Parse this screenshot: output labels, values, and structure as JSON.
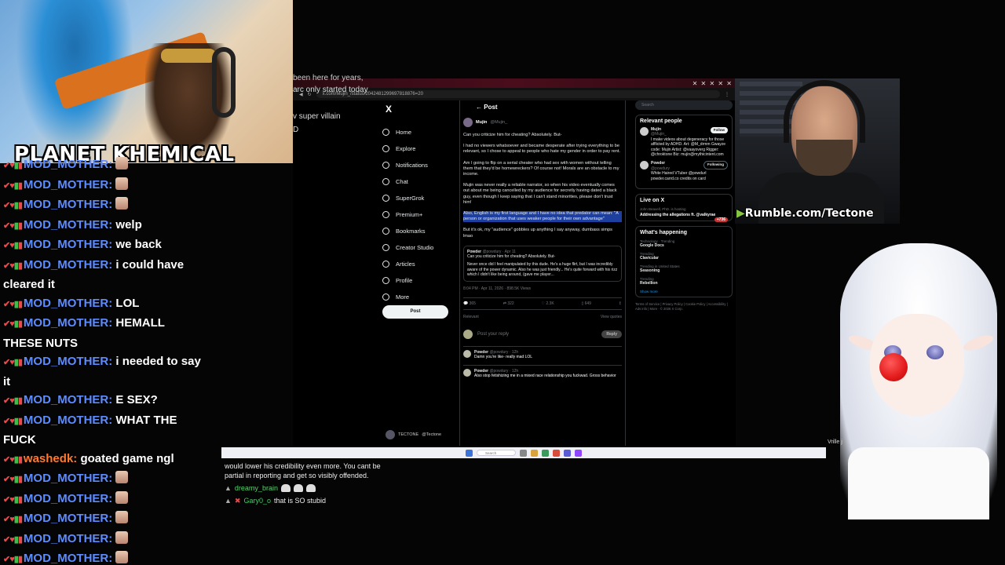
{
  "streamer": {
    "brand": "PLANET KHEMICAL"
  },
  "chat": {
    "messages": [
      {
        "user": "MOD_MOTHER:",
        "text": "",
        "emote": true,
        "color": "#5d8cff"
      },
      {
        "user": "MOD_MOTHER:",
        "text": "",
        "emote": true,
        "color": "#5d8cff"
      },
      {
        "user": "MOD_MOTHER:",
        "text": "",
        "emote": true,
        "color": "#5d8cff"
      },
      {
        "user": "MOD_MOTHER:",
        "text": "welp",
        "emote": false,
        "color": "#5d8cff"
      },
      {
        "user": "MOD_MOTHER:",
        "text": "we back",
        "emote": false,
        "color": "#5d8cff"
      },
      {
        "user": "MOD_MOTHER:",
        "text": "i could have cleared it",
        "emote": false,
        "color": "#5d8cff"
      },
      {
        "user": "MOD_MOTHER:",
        "text": "LOL",
        "emote": false,
        "color": "#5d8cff"
      },
      {
        "user": "MOD_MOTHER:",
        "text": "HEMALL THESE NUTS",
        "emote": false,
        "color": "#5d8cff"
      },
      {
        "user": "MOD_MOTHER:",
        "text": "i needed to say it",
        "emote": false,
        "color": "#5d8cff"
      },
      {
        "user": "MOD_MOTHER:",
        "text": "E SEX?",
        "emote": false,
        "color": "#5d8cff"
      },
      {
        "user": "MOD_MOTHER:",
        "text": "WHAT THE FUCK",
        "emote": false,
        "color": "#5d8cff"
      },
      {
        "user": "washedk:",
        "text": "goated game ngl",
        "emote": false,
        "color": "#ff7a2f"
      },
      {
        "user": "MOD_MOTHER:",
        "text": "",
        "emote": true,
        "color": "#5d8cff"
      },
      {
        "user": "MOD_MOTHER:",
        "text": "",
        "emote": true,
        "color": "#5d8cff"
      },
      {
        "user": "MOD_MOTHER:",
        "text": "",
        "emote": true,
        "color": "#5d8cff"
      },
      {
        "user": "MOD_MOTHER:",
        "text": "",
        "emote": true,
        "color": "#5d8cff"
      },
      {
        "user": "MOD_MOTHER:",
        "text": "",
        "emote": true,
        "color": "#5d8cff"
      },
      {
        "user": "MOD_MOTHER:",
        "text": "",
        "emote": true,
        "color": "#5d8cff"
      }
    ]
  },
  "browser": {
    "url": "x.com/Mujin_/status/2042481299697818876=20",
    "overlay_lines": [
      "been here for years,",
      "arc only started today",
      "v super villain",
      "D"
    ],
    "x_nav": {
      "logo": "X",
      "items": [
        "Home",
        "Explore",
        "Notifications",
        "Chat",
        "SuperGrok",
        "Premium+",
        "Bookmarks",
        "Creator Studio",
        "Articles",
        "Profile",
        "More"
      ],
      "post_label": "Post",
      "account_name": "TECTONE",
      "account_handle": "@Tectone"
    },
    "post": {
      "header": "Post",
      "author": "Mujin",
      "handle": "@Mujin_",
      "paragraphs": [
        "Can you criticize him for cheating? Absolutely. But-",
        "I had no viewers whatsoever and became desperate after trying everything to be relevant, so I chose to appeal to people who hate my gender in order to pay rent.",
        "Am I going to flip on a serial cheater who had sex with women without telling them that they'd be homewreckers? Of course not! Morals are an obstacle to my income.",
        "Mujin was never really a reliable narrator, so when his video eventually comes out about me being cancelled by my audience for secretly having dated a black guy, even though I keep saying that I can't stand minorities, please don't trust him!"
      ],
      "highlighted": "Also, English is my first language and I have no idea that predator can mean: \"A person or organization that uses weaker people for their own advantage\"",
      "closing": "But it's ok, my \"audience\" gobbles up anything I say anyway, dumbass simps lmao",
      "quote_author": "Powder",
      "quote_handle": "@powdury · Apr 11",
      "quote_line1": "Can you criticize him for cheating? Absolutely. But-",
      "quote_line2": "Never once did I feel manipulated by this dude. He's a huge flirt, but I was incredibly aware of the power dynamic. Also he was just friendly... He's quite forward with his rizz which I didn't like being around, (gave me player...",
      "timestamp": "8:04 PM · Apr 11, 2026 · 898.5K Views",
      "actions": [
        "365",
        "322",
        "2.3K",
        "649"
      ],
      "relevant": "Relevant",
      "view_quotes": "View quotes",
      "reply_placeholder": "Post your reply",
      "reply_button": "Reply",
      "replies": [
        {
          "name": "Powder",
          "handle": "@powdury · 12h",
          "text": "Damn you're like- really mad LOL"
        },
        {
          "name": "Powder",
          "handle": "@powdury · 12h",
          "text": "Also stop fetishizing me in a mixed race relationship you fuckwad. Gross behavior"
        }
      ]
    },
    "sidebar": {
      "search_placeholder": "Search",
      "relevant_title": "Relevant people",
      "people": [
        {
          "name": "Mujin",
          "handle": "@Mujin_",
          "bio": "I make videos about degeneracy for those afflicted by ADHD. Art: @M_drmm Gwayze code: Mujin Artist: @vaayoverg Rigger: @chroktone Biz: mujin@mythicintent.com",
          "button": "Follow"
        },
        {
          "name": "Powder",
          "handle": "@powdury",
          "bio": "White Haired VTuber @powdurl powder.carrd.co credits on card",
          "button": "Following"
        }
      ],
      "live_title": "Live on X",
      "live_host": "John Beavell, PhD. is hosting",
      "live_topic": "Addressing the allegations ft. @valkyrae",
      "live_count": "+736",
      "happening_title": "What's happening",
      "trends": [
        {
          "ctx": "Technology · Trending",
          "name": "Google Docs"
        },
        {
          "ctx": "Trending",
          "name": "Clavicular"
        },
        {
          "ctx": "Trending in United States",
          "name": "Seasoning"
        },
        {
          "ctx": "Trending",
          "name": "Rebellion"
        }
      ],
      "show_more": "Show more",
      "footer": "Terms of Service | Privacy Policy | Cookie Policy | Accessibility | Ads info | More · © 2026 X Corp."
    }
  },
  "taskbar": {
    "search_placeholder": "Search"
  },
  "lower_chat": {
    "text": "would lower his credibility even more. You cant be partial in reporting and get so visibly offended.",
    "line1_user": "dreamy_brain",
    "line2_user": "Gary0_o",
    "line2_text": "that is SO stubid"
  },
  "cam_right": {
    "label": "Rumble.com/Tectone"
  },
  "vtuber": {
    "name": "Vrille j"
  }
}
